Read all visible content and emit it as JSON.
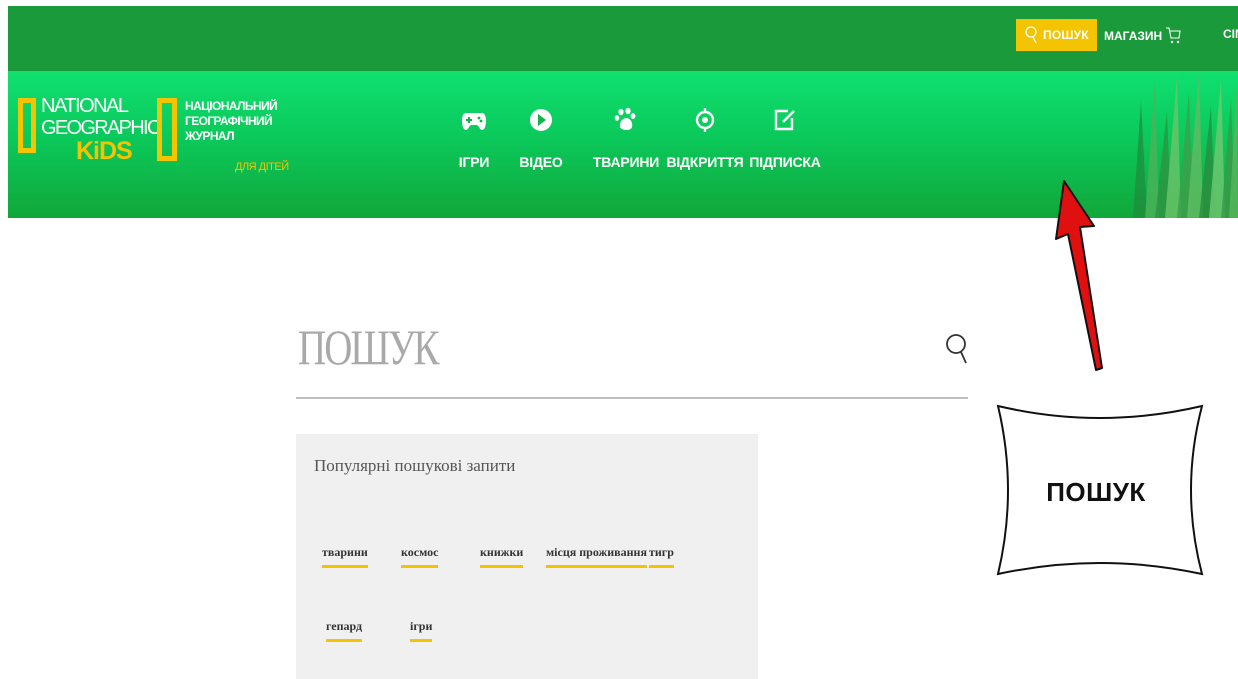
{
  "header": {
    "search_label": "ПОШУК",
    "shop_label": "МАГАЗИН",
    "family_label": "СІМ",
    "logo_primary": {
      "line1": "NATIONAL",
      "line2": "GEOGRAPHIC",
      "line3": "KiDS"
    },
    "logo_secondary": {
      "line1": "НАЦІОНАЛЬНИЙ",
      "line2": "ГЕОГРАФІЧНИЙ",
      "line3": "ЖУРНАЛ",
      "line4": "ДЛЯ ДІТЕЙ"
    },
    "nav": [
      {
        "label": "ІГРИ",
        "icon": "gamepad-icon"
      },
      {
        "label": "ВІДЕО",
        "icon": "play-icon"
      },
      {
        "label": "ТВАРИНИ",
        "icon": "paw-icon"
      },
      {
        "label": "ВІДКРИТТЯ",
        "icon": "target-icon"
      },
      {
        "label": "ПІДПИСКА",
        "icon": "edit-icon"
      }
    ]
  },
  "search": {
    "title": "ПОШУК",
    "popular_title": "Популярні пошукові запити",
    "tags": [
      "тварини",
      "космос",
      "книжки",
      "місця проживання",
      "тигр",
      "гепард",
      "ігри"
    ]
  },
  "callout": {
    "label": "ПОШУК"
  },
  "colors": {
    "accent": "#f5c400",
    "green_dark": "#1a9a3a",
    "green_bright": "#0fe070",
    "arrow": "#e01010"
  }
}
